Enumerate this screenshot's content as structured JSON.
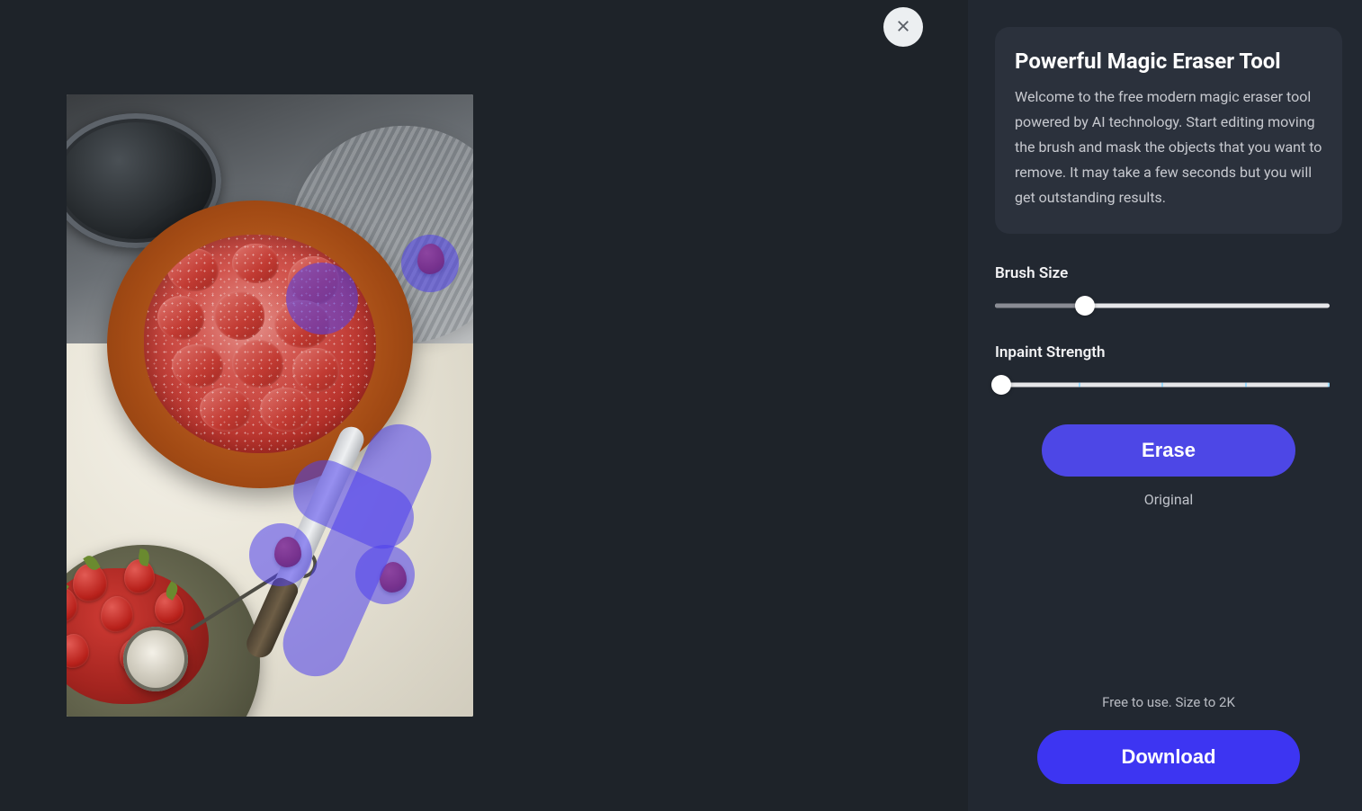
{
  "panel": {
    "title": "Powerful Magic Eraser Tool",
    "description": "Welcome to the free modern magic eraser tool powered by AI technology. Start editing moving the brush and mask the objects that you want to remove. It may take a few seconds but you will get outstanding results."
  },
  "controls": {
    "brush_size": {
      "label": "Brush Size",
      "value": 27,
      "min": 0,
      "max": 100
    },
    "inpaint_strength": {
      "label": "Inpaint Strength",
      "value": 0,
      "min": 0,
      "max": 100
    }
  },
  "buttons": {
    "erase": "Erase",
    "original": "Original",
    "download": "Download"
  },
  "footer": {
    "note": "Free to use. Size to 2K"
  },
  "canvas": {
    "subject": "Strawberry galette with fresh strawberries on parchment; knife and sifter",
    "mask_color": "#4e40ec",
    "masked_regions": [
      "stray strawberry top-right of galette",
      "filling patch on galette top",
      "stray strawberry below-left galette",
      "knife with handle",
      "stray strawberry right of knife"
    ]
  }
}
